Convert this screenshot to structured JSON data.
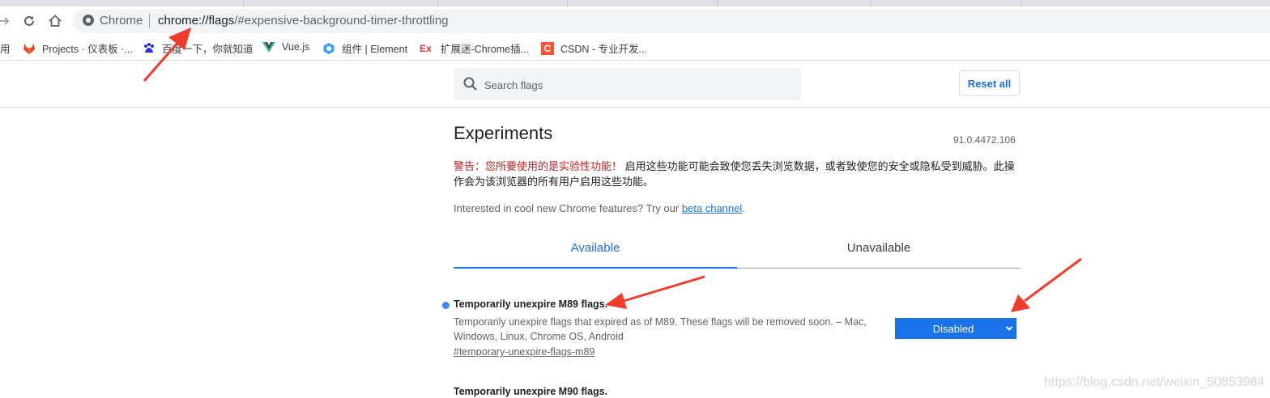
{
  "browser": {
    "omnibox_site": "Chrome",
    "url_host": "chrome://flags",
    "url_path": "/#expensive-background-timer-throttling"
  },
  "bookmarks": [
    {
      "label": "用",
      "icon": "apps-icon"
    },
    {
      "label": "Projects · 仪表板 ·...",
      "icon": "gitlab-icon"
    },
    {
      "label": "百度一下，你就知道",
      "icon": "baidu-icon"
    },
    {
      "label": "Vue.js",
      "icon": "vue-icon"
    },
    {
      "label": "组件 | Element",
      "icon": "element-icon"
    },
    {
      "label": "扩展迷-Chrome插...",
      "icon": "extfans-icon"
    },
    {
      "label": "CSDN - 专业开发...",
      "icon": "csdn-icon"
    }
  ],
  "header": {
    "search_placeholder": "Search flags",
    "reset_label": "Reset all"
  },
  "page": {
    "title": "Experiments",
    "version": "91.0.4472.106",
    "warning_strong": "警告：您所要使用的是实验性功能！",
    "warning_text": "启用这些功能可能会致使您丢失浏览数据，或者致使您的安全或隐私受到威胁。此操作会为该浏览器的所有用户启用这些功能。",
    "interested_text": "Interested in cool new Chrome features? Try our ",
    "beta_link": "beta channel",
    "interested_end": "."
  },
  "tabs": [
    {
      "label": "Available",
      "active": true
    },
    {
      "label": "Unavailable",
      "active": false
    }
  ],
  "experiments": [
    {
      "name": "Temporarily unexpire M89 flags.",
      "description": "Temporarily unexpire flags that expired as of M89. These flags will be removed soon. – Mac, Windows, Linux, Chrome OS, Android",
      "permalink": "#temporary-unexpire-flags-m89",
      "value": "Disabled"
    },
    {
      "name": "Temporarily unexpire M90 flags."
    }
  ],
  "watermark": "https://blog.csdn.net/weixin_50853984",
  "colors": {
    "accent": "#1a73e8",
    "warning": "#c5221f",
    "annotation_arrow": "#f03c2a"
  }
}
